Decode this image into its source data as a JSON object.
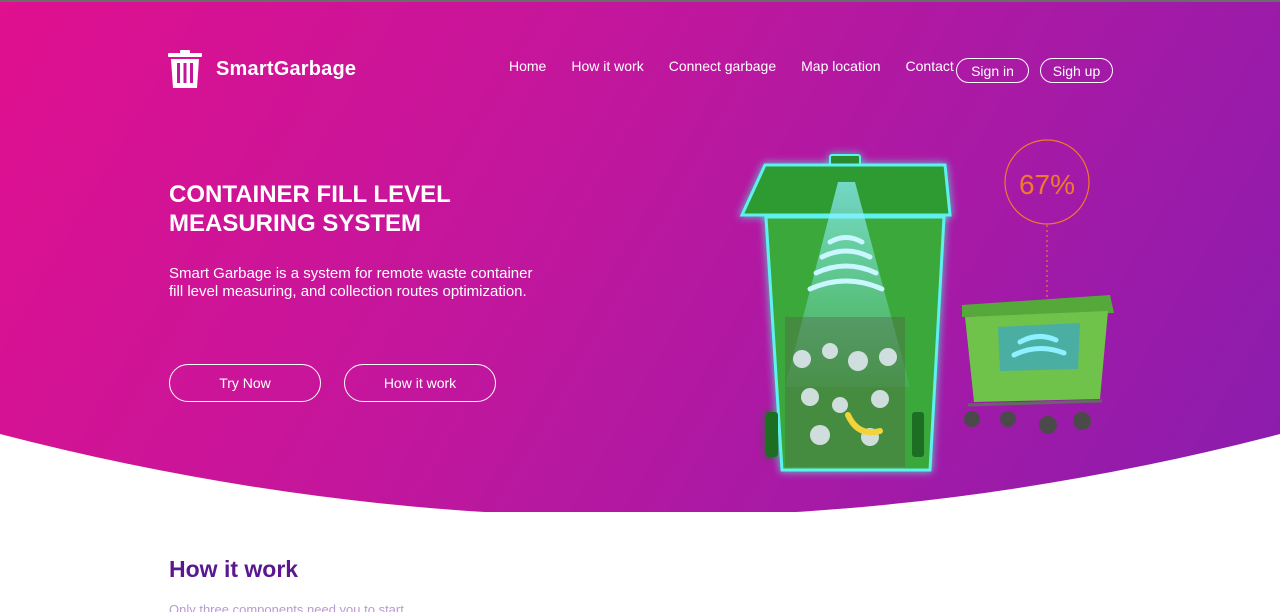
{
  "brand": {
    "name": "SmartGarbage",
    "logo_icon": "trash-bin-icon"
  },
  "nav": {
    "items": [
      "Home",
      "How it work",
      "Connect garbage",
      "Map location",
      "Contact"
    ],
    "sign_in": "Sign in",
    "sign_up": "Sigh up"
  },
  "hero": {
    "title_line1": "CONTAINER FILL LEVEL",
    "title_line2": "MEASURING SYSTEM",
    "description": "Smart Garbage is a system for remote waste container fill level measuring, and collection routes optimization.",
    "primary_button": "Try Now",
    "secondary_button": "How it work",
    "fill_level": "67%"
  },
  "section": {
    "title": "How it work",
    "subtitle": "Only three components need you to start"
  },
  "colors": {
    "gradient_start": "#e0108f",
    "gradient_end": "#8a1cae",
    "accent_orange": "#f07a2a",
    "bin_green": "#3fa83a",
    "section_title": "#5a1890"
  }
}
